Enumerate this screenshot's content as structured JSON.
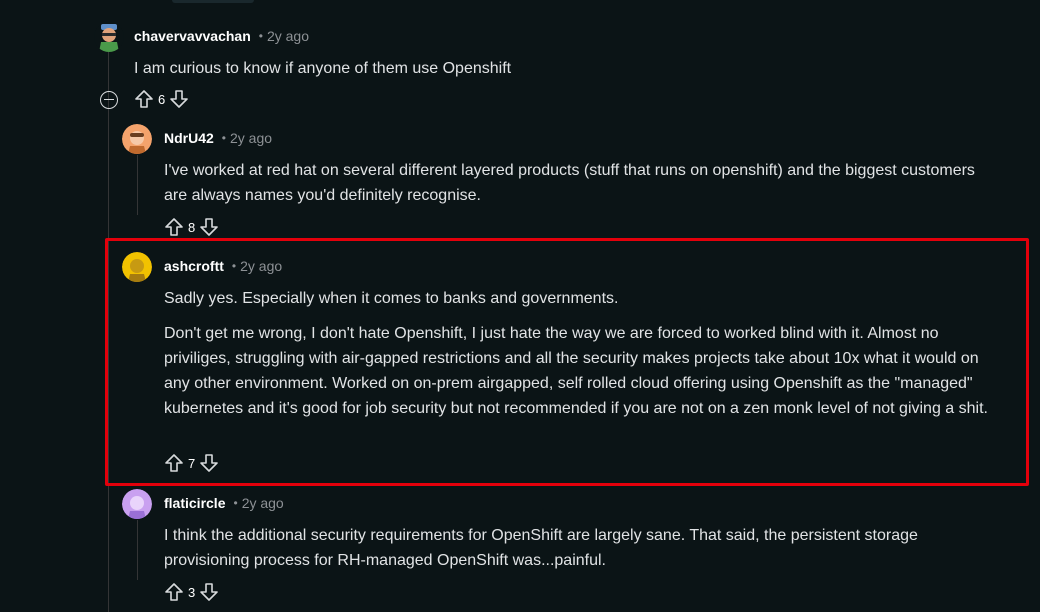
{
  "comments": [
    {
      "author": "chavervavvachan",
      "time": "2y ago",
      "paragraphs": [
        "I am curious to know if anyone of them use Openshift"
      ],
      "score": "6"
    },
    {
      "author": "NdrU42",
      "time": "2y ago",
      "paragraphs": [
        "I've worked at red hat on several different layered products (stuff that runs on openshift) and the biggest customers are always names you'd definitely recognise."
      ],
      "score": "8"
    },
    {
      "author": "ashcroftt",
      "time": "2y ago",
      "paragraphs": [
        "Sadly yes. Especially when it comes to banks and governments.",
        "Don't get me wrong, I don't hate Openshift, I just hate the way we are forced to worked blind with it. Almost no priviliges, struggling with air-gapped restrictions and all the security makes projects take about 10x what it would on any other environment. Worked on on-prem airgapped, self rolled cloud offering using Openshift as the \"managed\" kubernetes and it's good for job security but not recommended if you are not on a zen monk level of not giving a shit."
      ],
      "score": "7"
    },
    {
      "author": "flaticircle",
      "time": "2y ago",
      "paragraphs": [
        "I think the additional security requirements for OpenShift are largely sane. That said, the persistent storage provisioning process for RH-managed OpenShift was...painful."
      ],
      "score": "3"
    }
  ],
  "separator": "•",
  "colors": {
    "background": "#0b1416",
    "highlight": "#e3000b",
    "text": "#e1e3e5",
    "meta": "#8d9195"
  },
  "icons": {
    "upvote": "upvote-arrow-icon",
    "downvote": "downvote-arrow-icon",
    "collapse": "collapse-thread-icon"
  }
}
